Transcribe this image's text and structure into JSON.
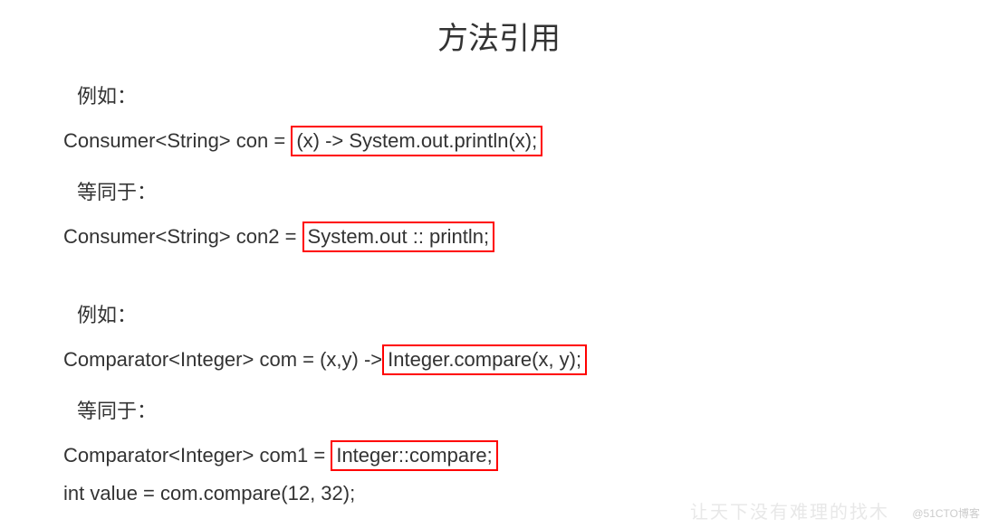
{
  "title": "方法引用",
  "example_label_1": "例如：",
  "line1_prefix": "Consumer<String> con = ",
  "line1_boxed": "(x) -> System.out.println(x);",
  "equal_label_1": "等同于：",
  "line2_prefix": "Consumer<String> con2 = ",
  "line2_boxed": "System.out :: println;",
  "example_label_2": "例如：",
  "line3_prefix": "Comparator<Integer> com = (x,y) ->",
  "line3_boxed": "Integer.compare(x, y);",
  "equal_label_2": "等同于：",
  "line4_prefix": "Comparator<Integer> com1 = ",
  "line4_boxed": "Integer::compare;",
  "line5": "int value = com.compare(12, 32);",
  "watermark": "@51CTO博客",
  "watermark_ghost": "让天下没有难理的找木"
}
